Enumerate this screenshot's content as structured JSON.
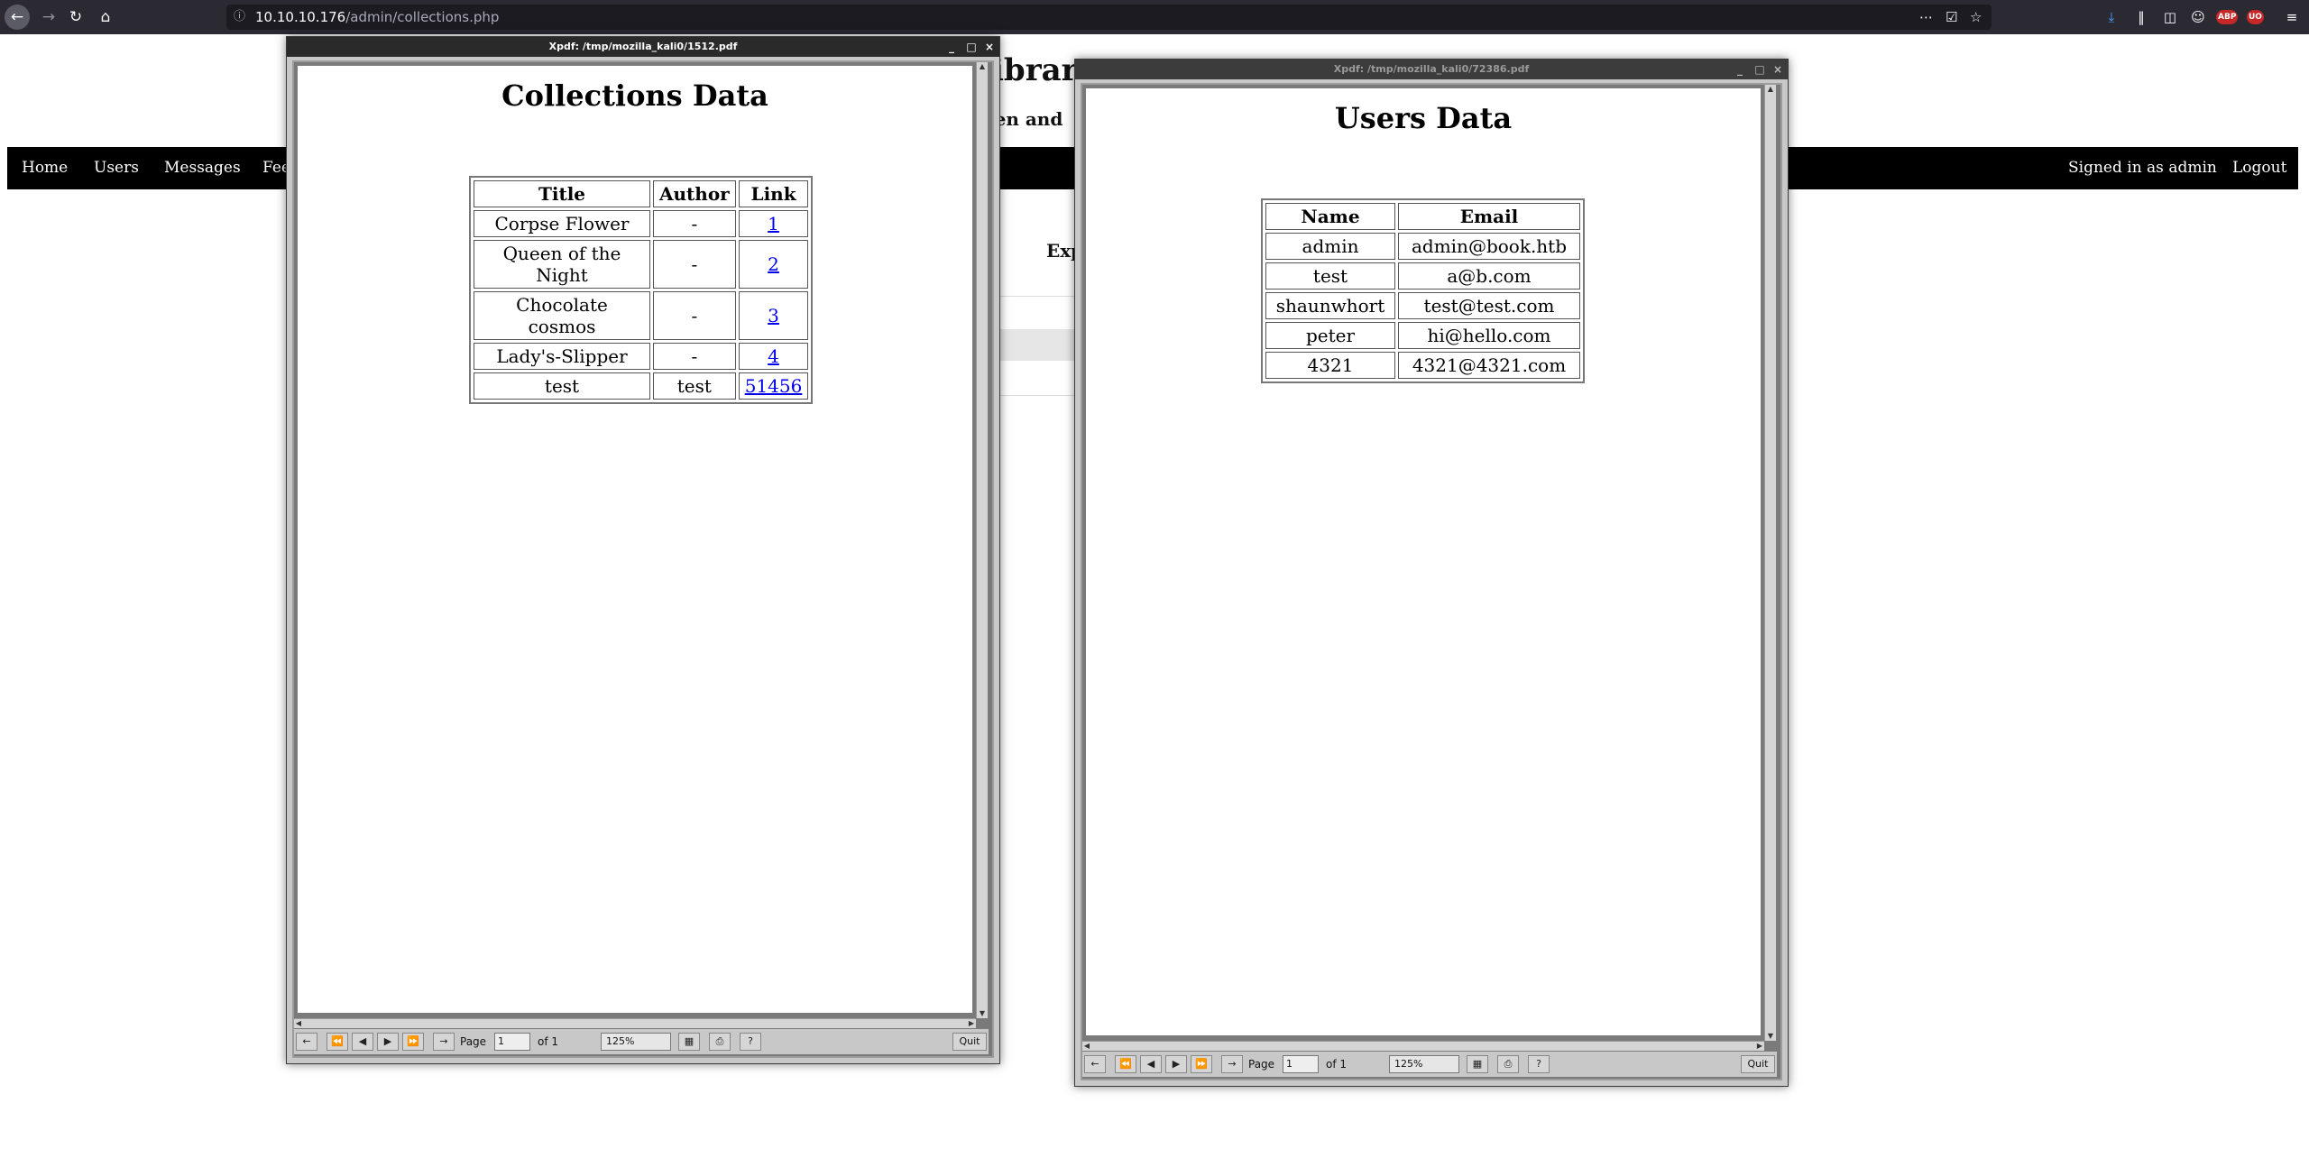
{
  "browser": {
    "url_host": "10.10.10.176",
    "url_path": "/admin/collections.php"
  },
  "page": {
    "title_fragment": "ibrar",
    "subtitle_fragment": "len and",
    "nav": {
      "home": "Home",
      "users": "Users",
      "messages": "Messages",
      "feedback_fragment": "Fee",
      "signed_in": "Signed in as admin",
      "logout": "Logout"
    },
    "content_fragment": "Exp"
  },
  "xpdf_collections": {
    "window_title": "Xpdf: /tmp/mozilla_kali0/1512.pdf",
    "heading": "Collections Data",
    "columns": [
      "Title",
      "Author",
      "Link"
    ],
    "rows": [
      {
        "title": "Corpse Flower",
        "author": "-",
        "link": "1"
      },
      {
        "title": "Queen of the Night",
        "author": "-",
        "link": "2"
      },
      {
        "title": "Chocolate cosmos",
        "author": "-",
        "link": "3"
      },
      {
        "title": "Lady's-Slipper",
        "author": "-",
        "link": "4"
      },
      {
        "title": "test",
        "author": "test",
        "link": "51456"
      }
    ],
    "toolbar": {
      "page_label": "Page",
      "page_value": "1",
      "of_label": "of 1",
      "zoom": "125%",
      "quit": "Quit"
    }
  },
  "xpdf_users": {
    "window_title": "Xpdf: /tmp/mozilla_kali0/72386.pdf",
    "heading": "Users Data",
    "columns": [
      "Name",
      "Email"
    ],
    "rows": [
      {
        "name": "admin",
        "email": "admin@book.htb"
      },
      {
        "name": "test",
        "email": "a@b.com"
      },
      {
        "name": "shaunwhort",
        "email": "test@test.com"
      },
      {
        "name": "peter",
        "email": "hi@hello.com"
      },
      {
        "name": "4321",
        "email": "4321@4321.com"
      }
    ],
    "toolbar": {
      "page_label": "Page",
      "page_value": "1",
      "of_label": "of 1",
      "zoom": "125%",
      "quit": "Quit"
    }
  }
}
